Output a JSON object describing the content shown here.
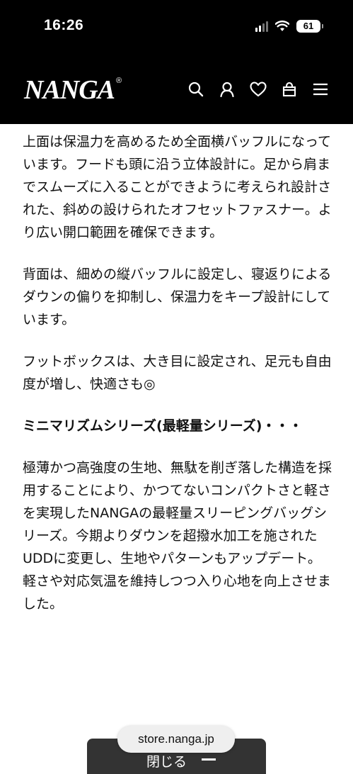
{
  "status_bar": {
    "time": "16:26",
    "battery": "61"
  },
  "header": {
    "logo": "NANGA",
    "logo_mark": "®",
    "icons": [
      "search-icon",
      "account-icon",
      "heart-icon",
      "cart-icon",
      "menu-icon"
    ]
  },
  "article": {
    "paragraphs": [
      "上面は保温力を高めるため全面横バッフルになっています。フードも頭に沿う立体設計に。足から肩までスムーズに入ることができように考えられ設計された、斜めの設けられたオフセットファスナー。より広い開口範囲を確保できます。",
      "背面は、細めの縦バッフルに設定し、寝返りによるダウンの偏りを抑制し、保温力をキープ設計にしています。",
      "フットボックスは、大き目に設定され、足元も自由度が増し、快適さも◎",
      "ミニマリズムシリーズ(最軽量シリーズ)・・・",
      "極薄かつ高強度の生地、無駄を削ぎ落した構造を採用することにより、かつてないコンパクトさと軽さを実現したNANGAの最軽量スリーピングバッグシリーズ。今期よりダウンを超撥水加工を施されたUDDに変更し、生地やパターンもアップデート。軽さや対応気温を維持しつつ入り心地を向上させました。"
    ]
  },
  "bottom": {
    "url": "store.nanga.jp",
    "close_label": "閉じる"
  },
  "colors": {
    "header_bg": "#000000",
    "text": "#111111",
    "close_bar": "#333333"
  }
}
